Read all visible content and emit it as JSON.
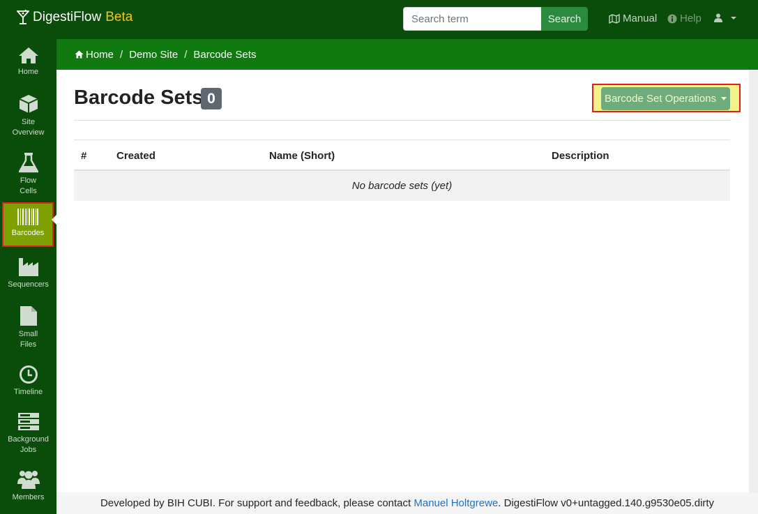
{
  "brand": {
    "name": "DigestiFlow",
    "tag": "Beta",
    "tag_color": "#f5c518",
    "icon": "cocktail-icon"
  },
  "search": {
    "placeholder": "Search term",
    "value": "",
    "button_label": "Search"
  },
  "topnav": {
    "manual_label": "Manual",
    "help_label": "Help",
    "user_icon": "user-icon"
  },
  "sidebar": {
    "items": [
      {
        "label_line1": "Home",
        "label_line2": "",
        "icon": "home-icon"
      },
      {
        "label_line1": "Site",
        "label_line2": "Overview",
        "icon": "cube-icon"
      },
      {
        "label_line1": "Flow",
        "label_line2": "Cells",
        "icon": "flask-icon"
      },
      {
        "label_line1": "Barcodes",
        "label_line2": "",
        "icon": "barcode-icon",
        "active": true
      },
      {
        "label_line1": "Sequencers",
        "label_line2": "",
        "icon": "factory-icon"
      },
      {
        "label_line1": "Small",
        "label_line2": "Files",
        "icon": "file-icon"
      },
      {
        "label_line1": "Timeline",
        "label_line2": "",
        "icon": "clock-icon"
      },
      {
        "label_line1": "Background",
        "label_line2": "Jobs",
        "icon": "server-icon"
      },
      {
        "label_line1": "Members",
        "label_line2": "",
        "icon": "users-icon"
      }
    ]
  },
  "breadcrumb": {
    "home": "Home",
    "site": "Demo Site",
    "current": "Barcode Sets",
    "separator": "/"
  },
  "page": {
    "title": "Barcode Sets",
    "count": "0",
    "operations_label": "Barcode Set Operations"
  },
  "table": {
    "columns": [
      "#",
      "Created",
      "Name (Short)",
      "Description"
    ],
    "empty_message": "No barcode sets (yet)"
  },
  "footer": {
    "prefix": "Developed by BIH CUBI. For support and feedback, please contact ",
    "contact_name": "Manuel Holtgrewe",
    "suffix": ". DigestiFlow v0+untagged.140.g9530e05.dirty"
  },
  "colors": {
    "nav_bg": "#0a4d0a",
    "breadcrumb_bg": "#107a10",
    "active_item_bg": "#7ea000",
    "highlight_border": "#e02020",
    "ops_button_bg": "#6fac7d"
  }
}
